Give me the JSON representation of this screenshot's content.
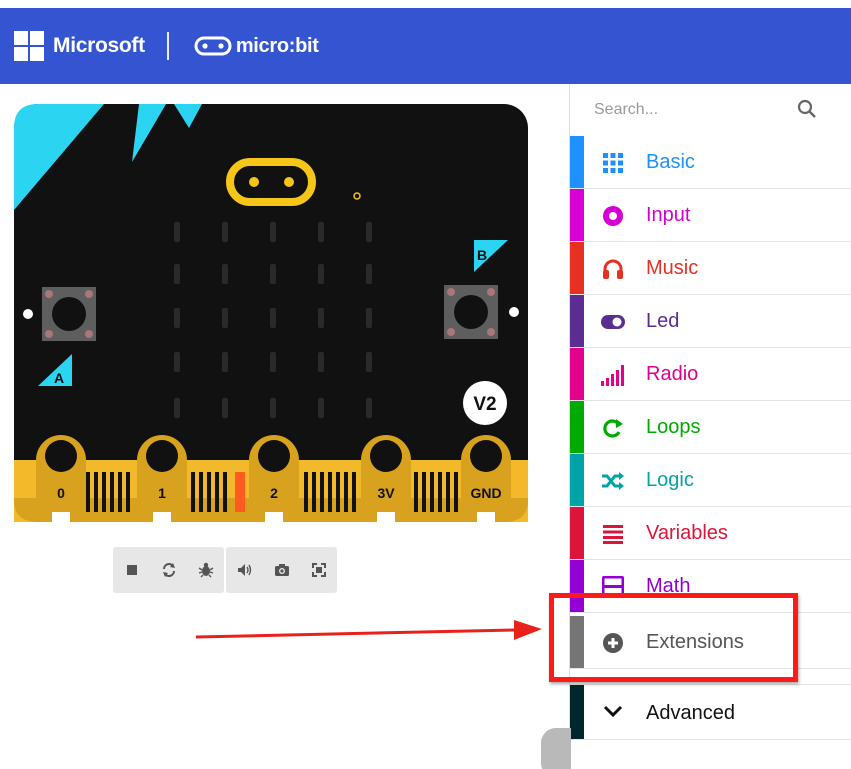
{
  "header": {
    "brand": "Microsoft",
    "product": "micro:bit",
    "background": "#3454d1"
  },
  "simulator": {
    "button_a_label": "A",
    "button_b_label": "B",
    "version_badge": "V2",
    "pins": [
      "0",
      "1",
      "2",
      "3V",
      "GND"
    ],
    "toolbar": [
      {
        "name": "stop",
        "icon": "stop-icon"
      },
      {
        "name": "restart",
        "icon": "restart-icon"
      },
      {
        "name": "debug",
        "icon": "bug-icon"
      },
      {
        "name": "mute",
        "icon": "speaker-icon"
      },
      {
        "name": "screenshot",
        "icon": "camera-icon"
      },
      {
        "name": "fullscreen",
        "icon": "fullscreen-icon"
      }
    ]
  },
  "toolbox": {
    "search_placeholder": "Search...",
    "categories": [
      {
        "label": "Basic",
        "color": "#1e90ff",
        "icon": "grid-icon"
      },
      {
        "label": "Input",
        "color": "#d400d4",
        "icon": "circle-dot-icon"
      },
      {
        "label": "Music",
        "color": "#e63022",
        "icon": "headphones-icon"
      },
      {
        "label": "Led",
        "color": "#5c2d91",
        "icon": "toggle-icon"
      },
      {
        "label": "Radio",
        "color": "#e3008c",
        "icon": "signal-bars-icon"
      },
      {
        "label": "Loops",
        "color": "#00aa00",
        "icon": "loop-arrow-icon"
      },
      {
        "label": "Logic",
        "color": "#00a4a6",
        "icon": "shuffle-icon"
      },
      {
        "label": "Variables",
        "color": "#dc143c",
        "icon": "list-lines-icon"
      },
      {
        "label": "Math",
        "color": "#9400d3",
        "icon": "calculator-icon"
      },
      {
        "label": "Extensions",
        "color": "#757575",
        "icon": "plus-circle-icon"
      },
      {
        "label": "Advanced",
        "color": "#00272b",
        "icon": "chevron-down-icon"
      }
    ]
  },
  "annotation": {
    "highlight_color": "#ff1a1a",
    "arrow_color": "#e8221b",
    "target": "Extensions"
  }
}
